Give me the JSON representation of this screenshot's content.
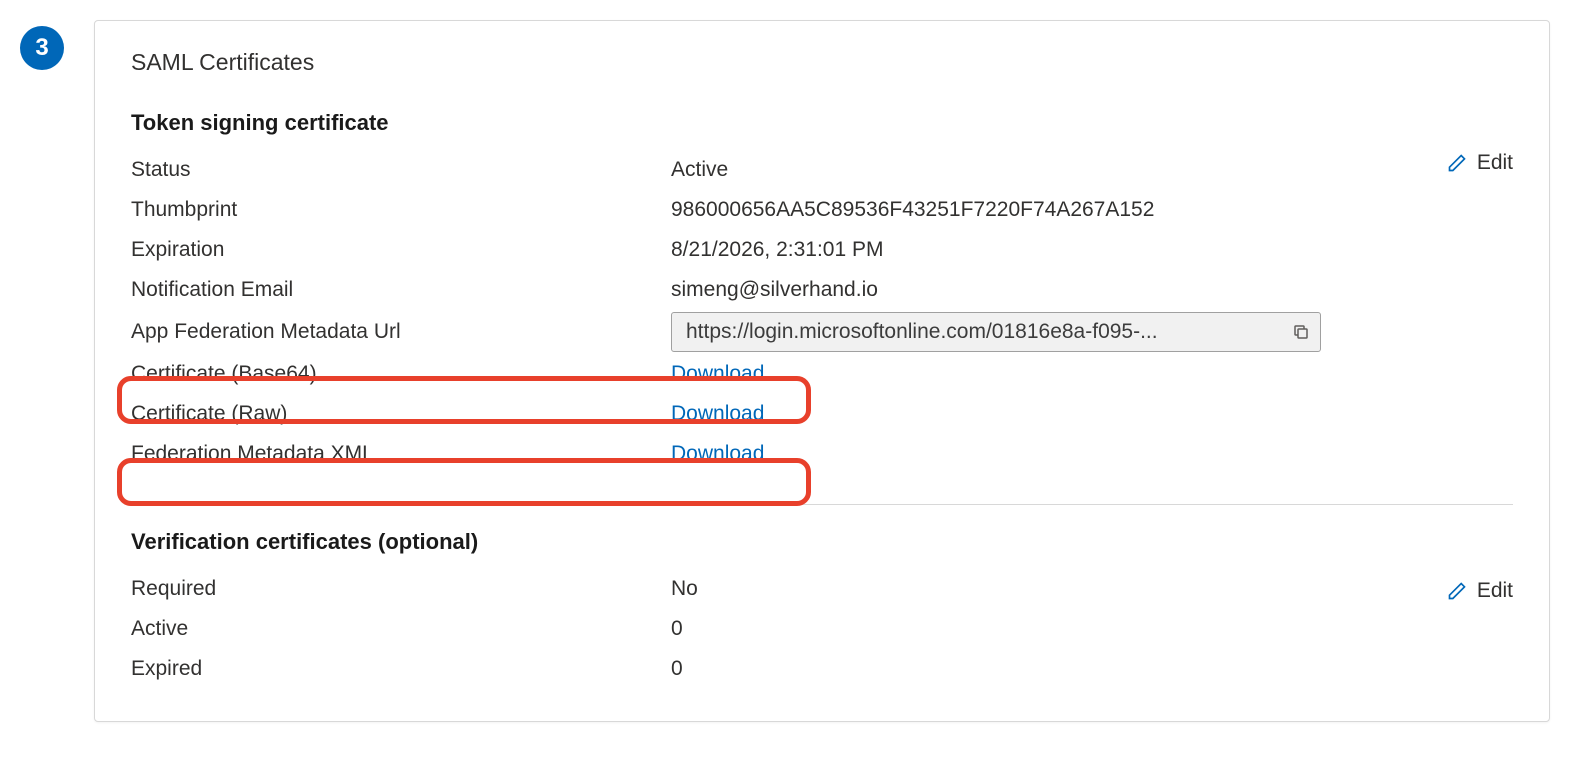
{
  "step_number": "3",
  "card_title": "SAML Certificates",
  "edit_label": "Edit",
  "token_signing": {
    "title": "Token signing certificate",
    "rows": {
      "status": {
        "label": "Status",
        "value": "Active"
      },
      "thumbprint": {
        "label": "Thumbprint",
        "value": "986000656AA5C89536F43251F7220F74A267A152"
      },
      "expiration": {
        "label": "Expiration",
        "value": "8/21/2026, 2:31:01 PM"
      },
      "notification_email": {
        "label": "Notification Email",
        "value": "simeng@silverhand.io"
      },
      "federation_url": {
        "label": "App Federation Metadata Url",
        "value": "https://login.microsoftonline.com/01816e8a-f095-..."
      },
      "cert_base64": {
        "label": "Certificate (Base64)",
        "action": "Download"
      },
      "cert_raw": {
        "label": "Certificate (Raw)",
        "action": "Download"
      },
      "fed_xml": {
        "label": "Federation Metadata XML",
        "action": "Download"
      }
    }
  },
  "verification": {
    "title": "Verification certificates (optional)",
    "rows": {
      "required": {
        "label": "Required",
        "value": "No"
      },
      "active": {
        "label": "Active",
        "value": "0"
      },
      "expired": {
        "label": "Expired",
        "value": "0"
      }
    }
  }
}
